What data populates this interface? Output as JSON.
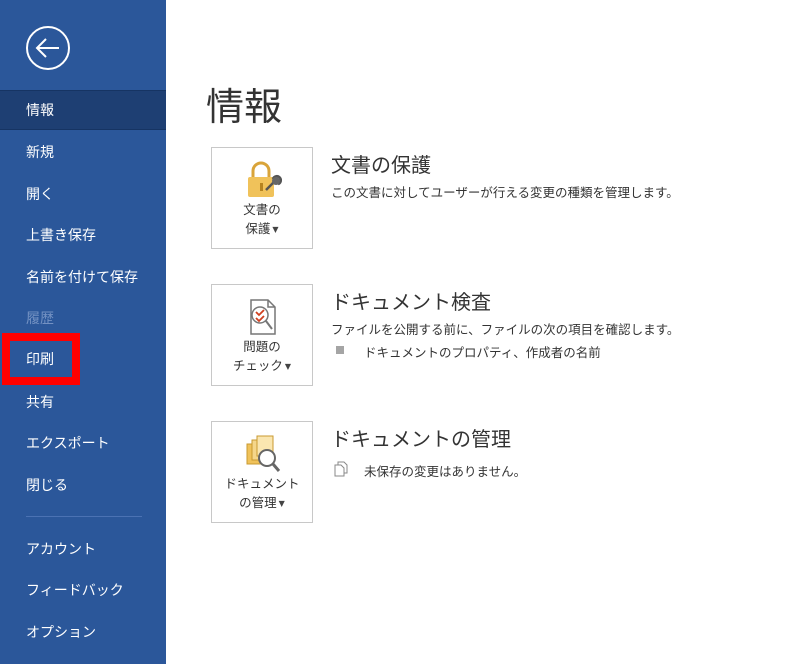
{
  "sidebar": {
    "items": [
      {
        "label": "情報"
      },
      {
        "label": "新規"
      },
      {
        "label": "開く"
      },
      {
        "label": "上書き保存"
      },
      {
        "label": "名前を付けて保存"
      },
      {
        "label": "履歴"
      },
      {
        "label": "印刷"
      },
      {
        "label": "共有"
      },
      {
        "label": "エクスポート"
      },
      {
        "label": "閉じる"
      },
      {
        "label": "アカウント"
      },
      {
        "label": "フィードバック"
      },
      {
        "label": "オプション"
      }
    ],
    "active_index": 0,
    "disabled_index": 5,
    "highlighted_index": 6
  },
  "main": {
    "title": "情報",
    "sections": [
      {
        "button_line1": "文書の",
        "button_line2": "保護",
        "icon": "lock-icon",
        "title": "文書の保護",
        "description": "この文書に対してユーザーが行える変更の種類を管理します。"
      },
      {
        "button_line1": "問題の",
        "button_line2": "チェック",
        "icon": "inspect-document-icon",
        "title": "ドキュメント検査",
        "description": "ファイルを公開する前に、ファイルの次の項目を確認します。",
        "bullets": [
          "ドキュメントのプロパティ、作成者の名前"
        ]
      },
      {
        "button_line1": "ドキュメント",
        "button_line2": "の管理",
        "icon": "manage-document-icon",
        "title": "ドキュメントの管理",
        "description": "未保存の変更はありません。"
      }
    ]
  },
  "colors": {
    "sidebar_bg": "#2b579a",
    "sidebar_active_bg": "#1e3f73",
    "highlight": "#ff0000",
    "icon_gold": "#e8b84a"
  }
}
